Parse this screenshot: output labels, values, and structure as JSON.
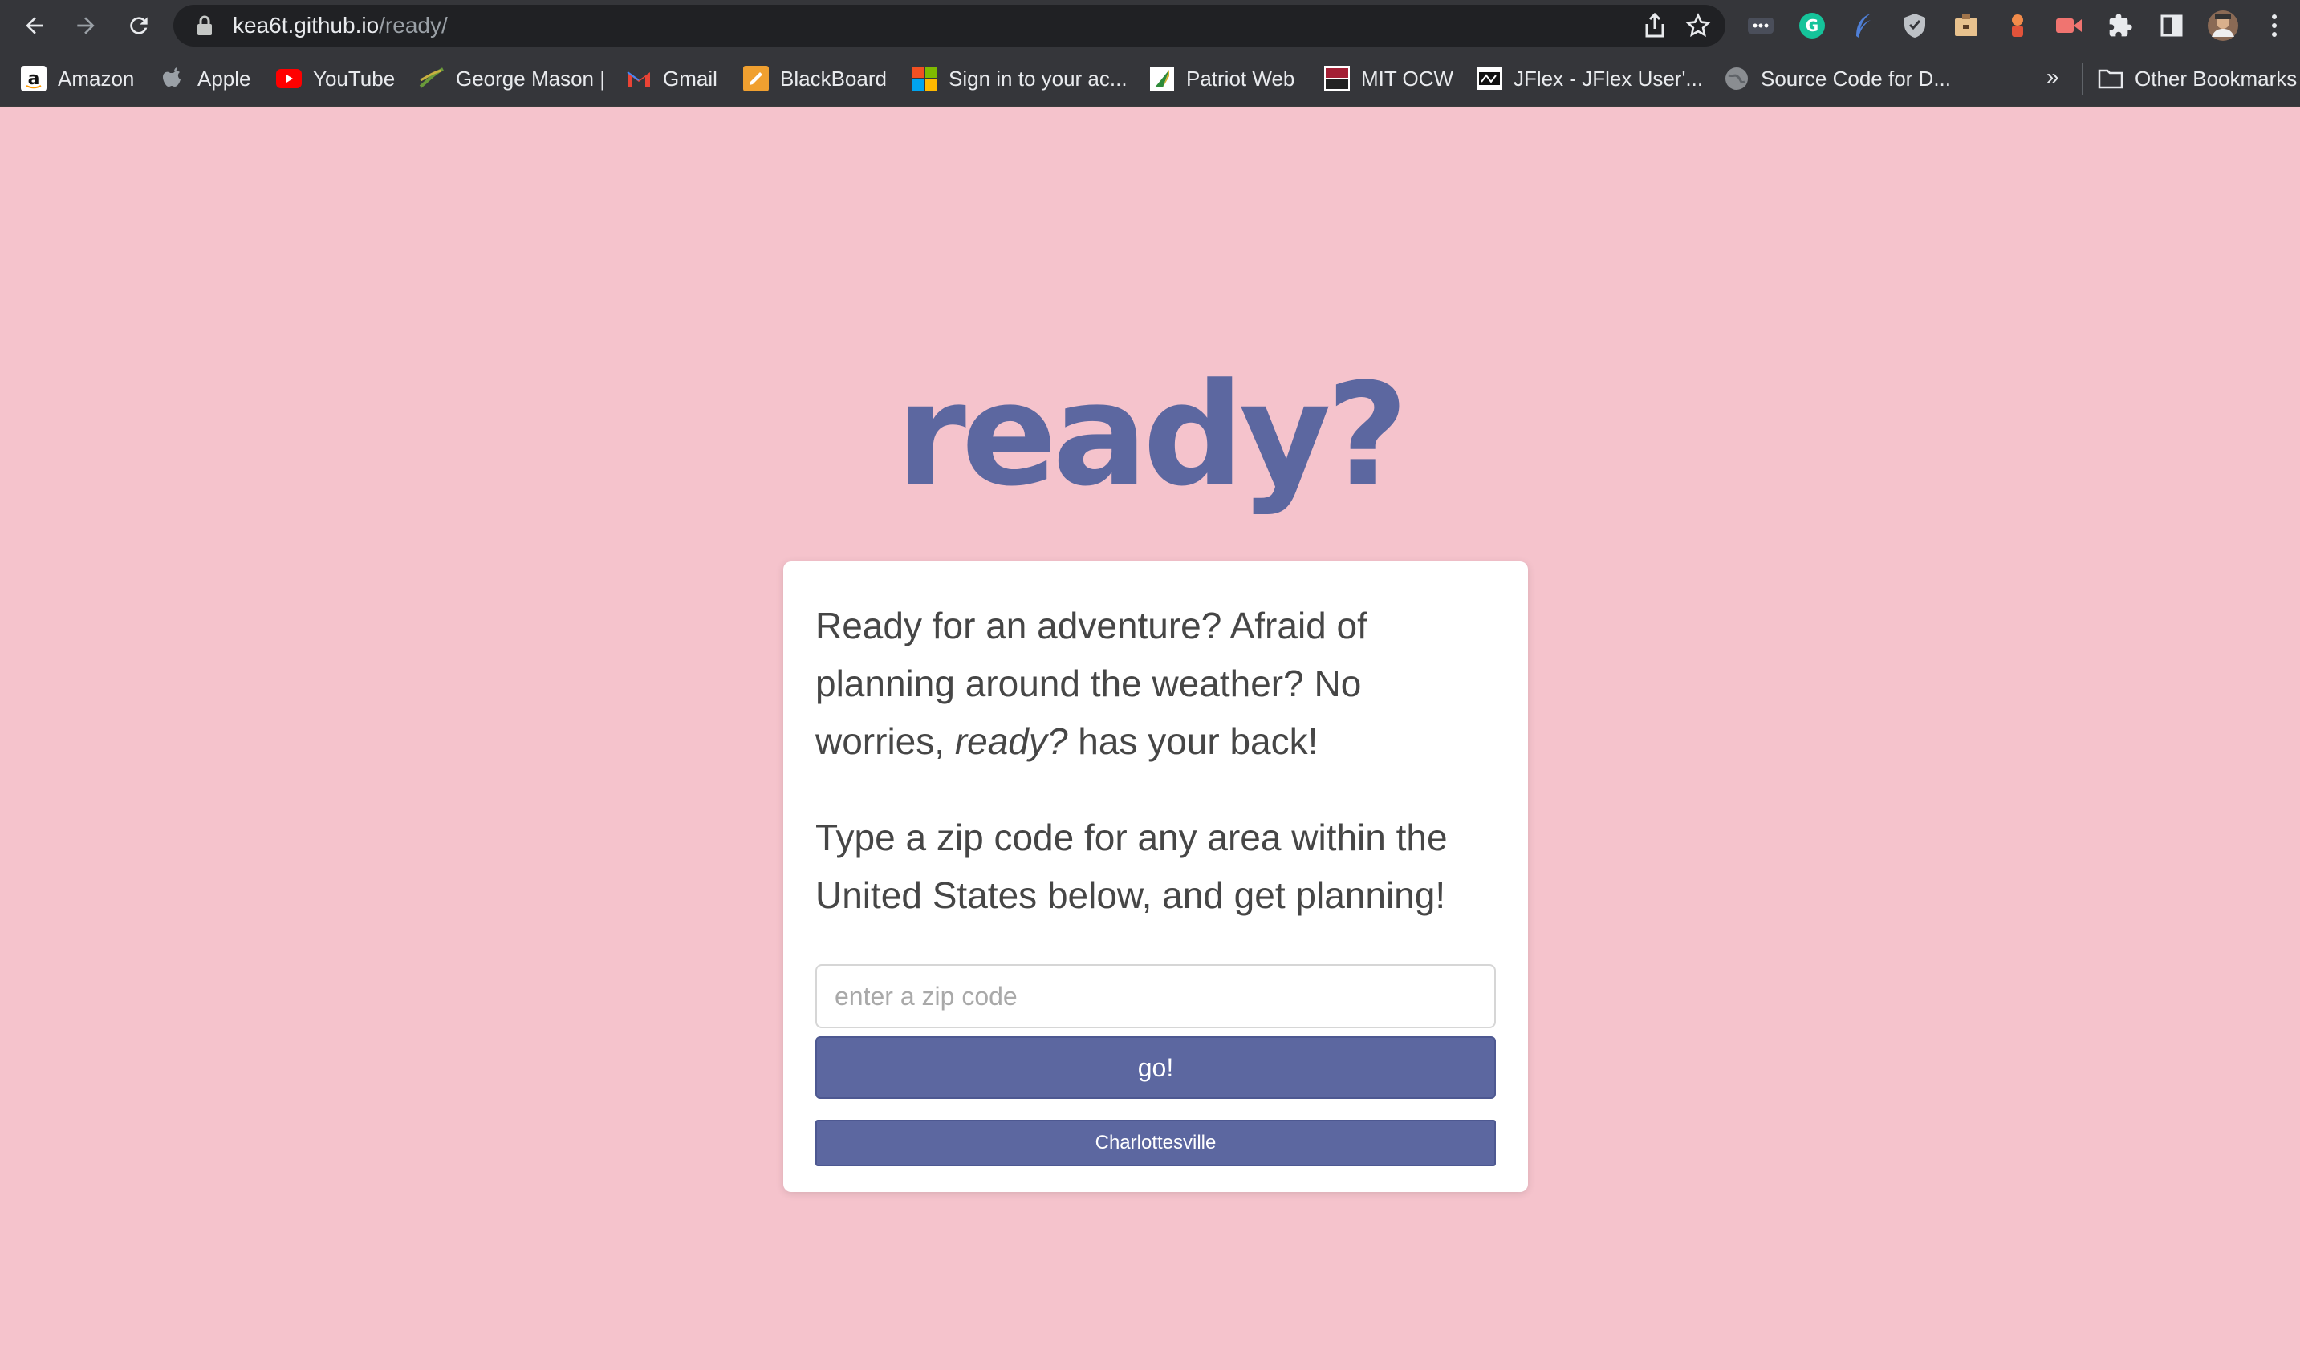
{
  "browser": {
    "url_host": "kea6t.github.io",
    "url_path": "/ready/",
    "bookmarks": [
      {
        "label": "Amazon",
        "icon": "amazon-icon"
      },
      {
        "label": "Apple",
        "icon": "apple-icon"
      },
      {
        "label": "YouTube",
        "icon": "youtube-icon"
      },
      {
        "label": "George Mason |",
        "icon": "george-mason-icon"
      },
      {
        "label": "Gmail",
        "icon": "gmail-icon"
      },
      {
        "label": "BlackBoard",
        "icon": "blackboard-icon"
      },
      {
        "label": "Sign in to your ac...",
        "icon": "microsoft-icon"
      },
      {
        "label": "Patriot Web",
        "icon": "patriot-web-icon"
      },
      {
        "label": "MIT OCW",
        "icon": "mit-ocw-icon"
      },
      {
        "label": "JFlex - JFlex User'...",
        "icon": "jflex-icon"
      },
      {
        "label": "Source Code for D...",
        "icon": "globe-icon"
      }
    ],
    "more_bookmarks": "»",
    "other_bookmarks": "Other Bookmarks"
  },
  "page": {
    "title": "ready?",
    "intro_before": "Ready for an adventure? Afraid of planning around the weather? No worries, ",
    "intro_em": "ready?",
    "intro_after": " has your back!",
    "instructions": "Type a zip code for any area within the United States below, and get planning!",
    "zip_placeholder": "enter a zip code",
    "zip_value": "",
    "go_label": "go!",
    "city_label": "Charlottesville"
  },
  "colors": {
    "background": "#f5c3cc",
    "accent": "#5c67a0",
    "chrome": "#35363a"
  }
}
